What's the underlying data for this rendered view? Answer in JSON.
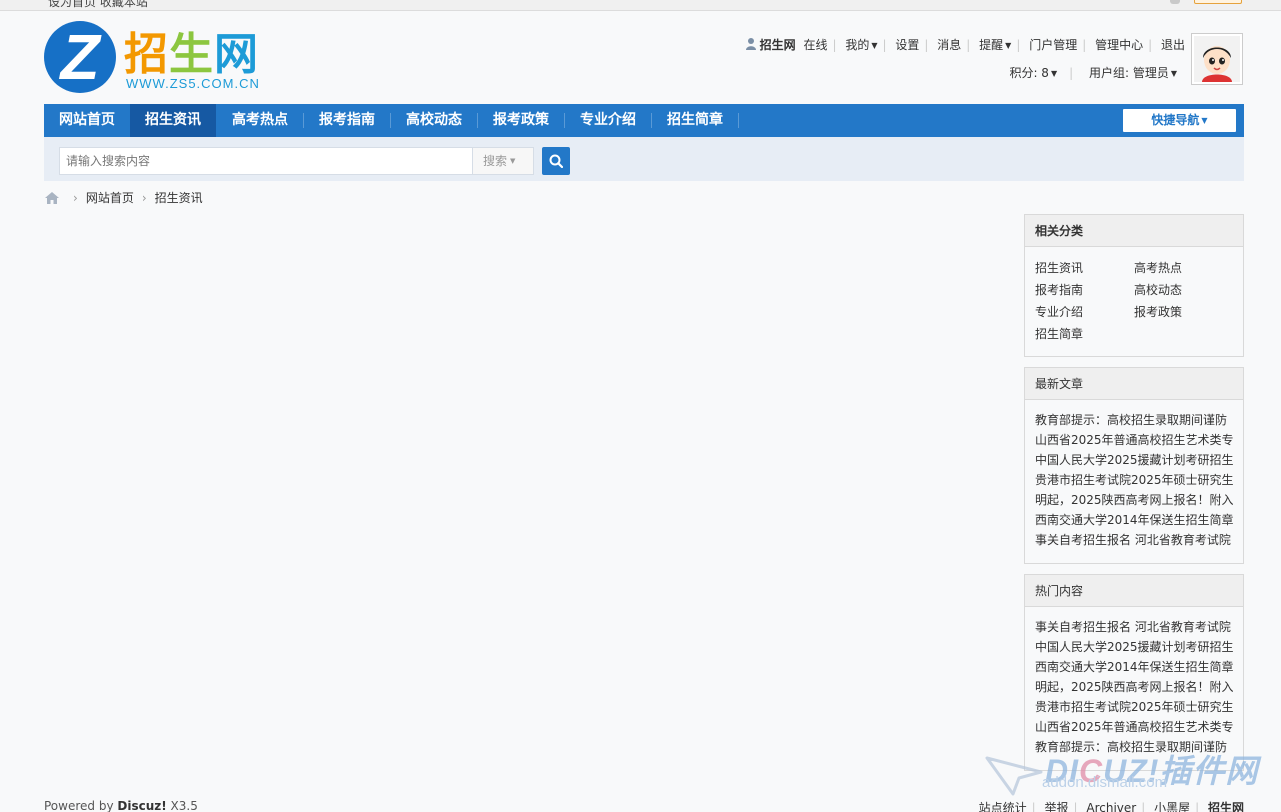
{
  "topbar": {
    "left_text": "设为首页    收藏本站"
  },
  "logo": {
    "chinese": "招生网",
    "chinese_parts": [
      "招",
      "生",
      "网"
    ],
    "url": "WWW.ZS5.COM.CN",
    "letter": "Z"
  },
  "user": {
    "name": "招生网",
    "status": "在线",
    "my": "我的",
    "settings": "设置",
    "messages": "消息",
    "remind": "提醒",
    "portal": "门户管理",
    "admin": "管理中心",
    "logout": "退出",
    "points": "积分: 8",
    "group": "用户组: 管理员"
  },
  "nav": {
    "items": [
      "网站首页",
      "招生资讯",
      "高考热点",
      "报考指南",
      "高校动态",
      "报考政策",
      "专业介绍",
      "招生简章"
    ],
    "active_index": 1,
    "quick": "快捷导航"
  },
  "search": {
    "placeholder": "请输入搜索内容",
    "type": "搜索"
  },
  "breadcrumb": {
    "home": "网站首页",
    "current": "招生资讯"
  },
  "sidebar": {
    "categories": {
      "title": "相关分类",
      "items": [
        "招生资讯",
        "高考热点",
        "报考指南",
        "高校动态",
        "专业介绍",
        "报考政策",
        "招生简章"
      ]
    },
    "latest": {
      "title": "最新文章",
      "items": [
        "教育部提示：高校招生录取期间谨防",
        "山西省2025年普通高校招生艺术类专",
        "中国人民大学2025援藏计划考研招生",
        "贵港市招生考试院2025年硕士研究生",
        "明起，2025陕西高考网上报名！附入",
        "西南交通大学2014年保送生招生简章",
        "事关自考招生报名 河北省教育考试院"
      ]
    },
    "hot": {
      "title": "热门内容",
      "items": [
        "事关自考招生报名 河北省教育考试院",
        "中国人民大学2025援藏计划考研招生",
        "西南交通大学2014年保送生招生简章",
        "明起，2025陕西高考网上报名！附入",
        "贵港市招生考试院2025年硕士研究生",
        "山西省2025年普通高校招生艺术类专",
        "教育部提示：高校招生录取期间谨防"
      ]
    }
  },
  "footer": {
    "powered_prefix": "Powered by ",
    "powered_brand": "Discuz!",
    "powered_version": " X3.5",
    "links": [
      "站点统计",
      "举报",
      "Archiver",
      "小黑屋",
      "招生网"
    ]
  },
  "watermark": {
    "brand_a": "DI",
    "brand_c": "C",
    "brand_b": "UZ!插件网",
    "domain": "addon.dismall.com"
  },
  "colors": {
    "nav": "#2378c8",
    "nav_active": "#1659a3",
    "logo_orange": "#f39800",
    "logo_green": "#8cc63f",
    "logo_blue": "#1d9bd7"
  }
}
